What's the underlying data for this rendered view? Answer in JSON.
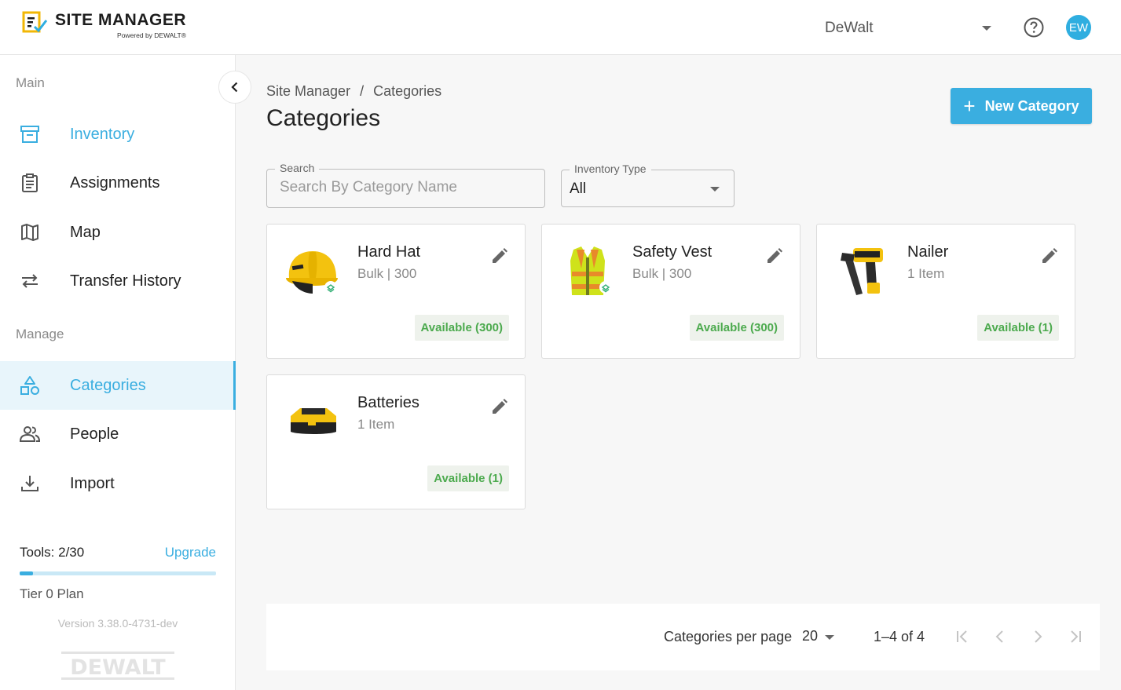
{
  "header": {
    "logo_title": "SITE MANAGER",
    "logo_sub": "Powered by DEWALT®",
    "org_name": "DeWalt",
    "avatar_initials": "EW"
  },
  "sidebar": {
    "section_main": "Main",
    "section_manage": "Manage",
    "main_items": [
      {
        "label": "Inventory",
        "icon": "archive-box-icon"
      },
      {
        "label": "Assignments",
        "icon": "clipboard-icon"
      },
      {
        "label": "Map",
        "icon": "map-icon"
      },
      {
        "label": "Transfer History",
        "icon": "transfer-arrows-icon"
      }
    ],
    "manage_items": [
      {
        "label": "Categories",
        "icon": "shapes-icon"
      },
      {
        "label": "People",
        "icon": "people-icon"
      },
      {
        "label": "Import",
        "icon": "download-icon"
      }
    ],
    "tools_label": "Tools: 2/30",
    "tools_used_fraction": 0.067,
    "upgrade_label": "Upgrade",
    "tier_label": "Tier 0 Plan",
    "version": "Version 3.38.0-4731-dev",
    "brand_footer": "DEWALT"
  },
  "main": {
    "breadcrumb": [
      "Site Manager",
      "/",
      "Categories"
    ],
    "title": "Categories",
    "new_button": "New Category",
    "search": {
      "label": "Search",
      "placeholder": "Search By Category Name",
      "value": ""
    },
    "inventory_type": {
      "label": "Inventory Type",
      "value": "All"
    },
    "cards": [
      {
        "title": "Hard Hat",
        "subtitle": "Bulk | 300",
        "badge": "Available (300)",
        "image": "hard-hat-image"
      },
      {
        "title": "Safety Vest",
        "subtitle": "Bulk | 300",
        "badge": "Available (300)",
        "image": "safety-vest-image"
      },
      {
        "title": "Nailer",
        "subtitle": "1 Item",
        "badge": "Available (1)",
        "image": "nailer-image"
      },
      {
        "title": "Batteries",
        "subtitle": "1 Item",
        "badge": "Available (1)",
        "image": "battery-image"
      }
    ],
    "pager": {
      "per_page_label": "Categories per page",
      "per_page_value": "20",
      "range": "1–4 of 4"
    }
  },
  "colors": {
    "accent": "#3aaee0",
    "available_text": "#4caa4e",
    "available_bg": "#eef2ec"
  }
}
